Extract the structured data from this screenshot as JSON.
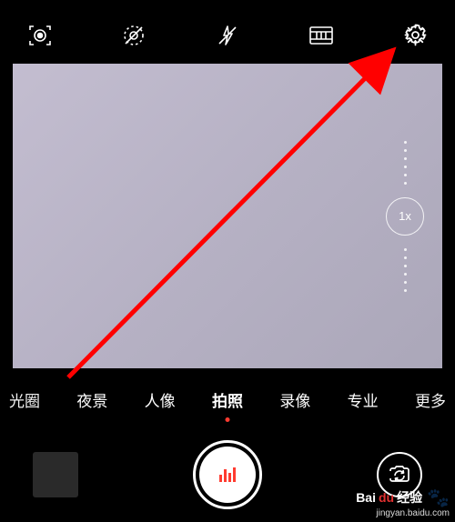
{
  "topbar": {
    "icons": [
      "lens-mode-icon",
      "live-photo-off-icon",
      "flash-off-icon",
      "filter-icon",
      "settings-icon"
    ]
  },
  "zoom": {
    "label": "1x"
  },
  "modes": {
    "items": [
      "光圈",
      "夜景",
      "人像",
      "拍照",
      "录像",
      "专业",
      "更多"
    ],
    "activeIndex": 3
  },
  "watermark": {
    "brand_left": "Bai",
    "brand_right": "du",
    "brand_suffix": "经验",
    "url": "jingyan.baidu.com"
  }
}
